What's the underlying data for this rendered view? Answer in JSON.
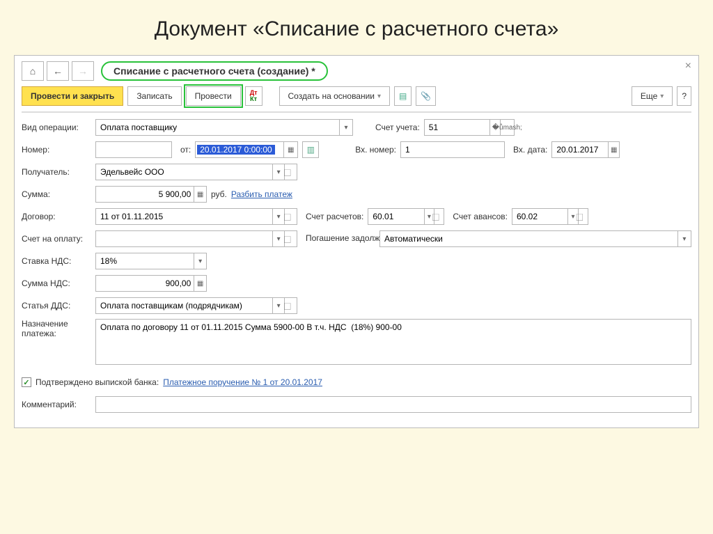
{
  "page_heading": "Документ «Списание с расчетного счета»",
  "doc_title": "Списание с расчетного счета (создание) *",
  "toolbar": {
    "post_close": "Провести и закрыть",
    "save": "Записать",
    "post": "Провести",
    "create_based": "Создать на основании",
    "more": "Еще",
    "help": "?"
  },
  "labels": {
    "op_type": "Вид операции:",
    "acct": "Счет учета:",
    "number": "Номер:",
    "from": "от:",
    "in_num": "Вх. номер:",
    "in_date": "Вх. дата:",
    "payee": "Получатель:",
    "sum": "Сумма:",
    "currency": "руб.",
    "split": "Разбить платеж",
    "contract": "Договор:",
    "calc_acct": "Счет расчетов:",
    "adv_acct": "Счет авансов:",
    "invoice": "Счет на оплату:",
    "debt": "Погашение задолженности:",
    "vat_rate": "Ставка НДС:",
    "vat_sum": "Сумма НДС:",
    "dds": "Статья ДДС:",
    "purpose": "Назначение платежа:",
    "confirmed": "Подтверждено выпиской банка:",
    "comment": "Комментарий:"
  },
  "values": {
    "op_type": "Оплата поставщику",
    "acct": "51",
    "date": "20.01.2017  0:00:00",
    "in_num": "1",
    "in_date": "20.01.2017",
    "payee": "Эдельвейс ООО",
    "sum": "5 900,00",
    "contract": "11 от 01.11.2015",
    "calc_acct": "60.01",
    "adv_acct": "60.02",
    "invoice": "",
    "debt": "Автоматически",
    "vat_rate": "18%",
    "vat_sum": "900,00",
    "dds": "Оплата поставщикам (подрядчикам)",
    "purpose": "Оплата по договору 11 от 01.11.2015 Сумма 5900-00 В т.ч. НДС  (18%) 900-00",
    "bank_link": "Платежное поручение № 1 от 20.01.2017",
    "comment": ""
  }
}
